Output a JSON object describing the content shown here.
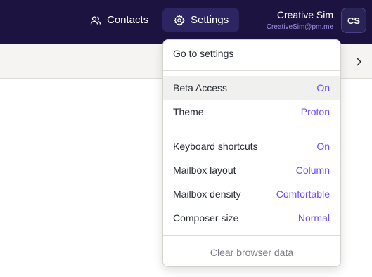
{
  "header": {
    "contacts_label": "Contacts",
    "settings_label": "Settings",
    "user_name": "Creative Sim",
    "user_email": "CreativeSim@pm.me",
    "avatar_initials": "CS"
  },
  "dropdown": {
    "go_to_settings": "Go to settings",
    "beta_access": {
      "label": "Beta Access",
      "value": "On"
    },
    "theme": {
      "label": "Theme",
      "value": "Proton"
    },
    "keyboard_shortcuts": {
      "label": "Keyboard shortcuts",
      "value": "On"
    },
    "mailbox_layout": {
      "label": "Mailbox layout",
      "value": "Column"
    },
    "mailbox_density": {
      "label": "Mailbox density",
      "value": "Comfortable"
    },
    "composer_size": {
      "label": "Composer size",
      "value": "Normal"
    },
    "clear_browser_data": "Clear browser data"
  },
  "colors": {
    "topbar_bg": "#1c1340",
    "accent": "#6d4aff",
    "email_text": "#9d95e6"
  },
  "icons": {
    "contacts": "users-icon",
    "settings": "gear-icon",
    "toolbar_next": "chevron-right-icon"
  }
}
